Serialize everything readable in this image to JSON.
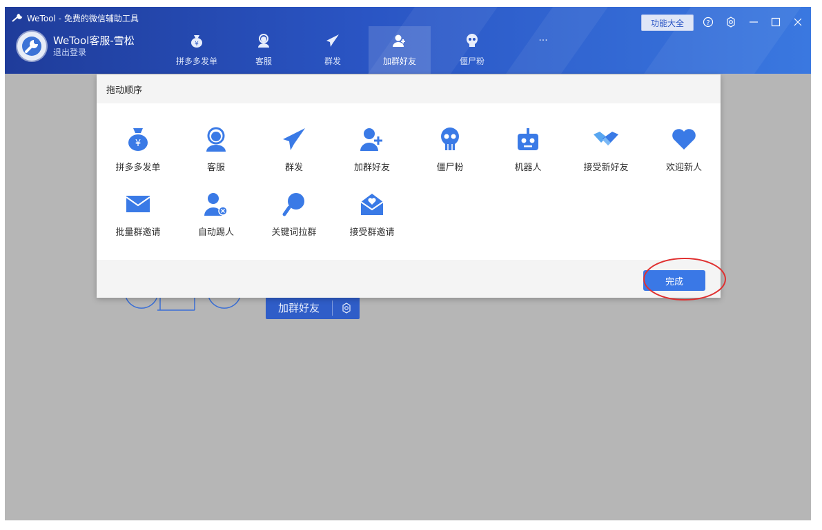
{
  "window": {
    "title": "WeTool - 免费的微信辅助工具",
    "features_button": "功能大全"
  },
  "profile": {
    "user_name": "WeTool客服-雪松",
    "logout": "退出登录"
  },
  "nav": {
    "tabs": [
      {
        "label": "拼多多发单",
        "icon": "money-bag-icon"
      },
      {
        "label": "客服",
        "icon": "headset-icon"
      },
      {
        "label": "群发",
        "icon": "paper-plane-icon"
      },
      {
        "label": "加群好友",
        "icon": "add-user-icon",
        "active": true
      },
      {
        "label": "僵尸粉",
        "icon": "skull-icon"
      },
      {
        "label": "···",
        "icon": "more-icon"
      }
    ]
  },
  "background": {
    "add_group_friend_button": "加群好友"
  },
  "modal": {
    "title": "拖动顺序",
    "items": [
      {
        "label": "拼多多发单",
        "icon": "money-bag-icon"
      },
      {
        "label": "客服",
        "icon": "headset-icon"
      },
      {
        "label": "群发",
        "icon": "paper-plane-icon"
      },
      {
        "label": "加群好友",
        "icon": "add-user-icon"
      },
      {
        "label": "僵尸粉",
        "icon": "skull-icon"
      },
      {
        "label": "机器人",
        "icon": "robot-icon"
      },
      {
        "label": "接受新好友",
        "icon": "handshake-icon"
      },
      {
        "label": "欢迎新人",
        "icon": "heart-icon"
      },
      {
        "label": "批量群邀请",
        "icon": "envelope-icon"
      },
      {
        "label": "自动踢人",
        "icon": "remove-user-icon"
      },
      {
        "label": "关键词拉群",
        "icon": "magnifier-icon"
      },
      {
        "label": "接受群邀请",
        "icon": "heart-envelope-icon"
      }
    ],
    "done_button": "完成"
  },
  "colors": {
    "accent": "#3a78e6",
    "header_dark": "#1f3c9a",
    "overlay": "#b6b6b6",
    "highlight_ellipse": "#e03030"
  }
}
